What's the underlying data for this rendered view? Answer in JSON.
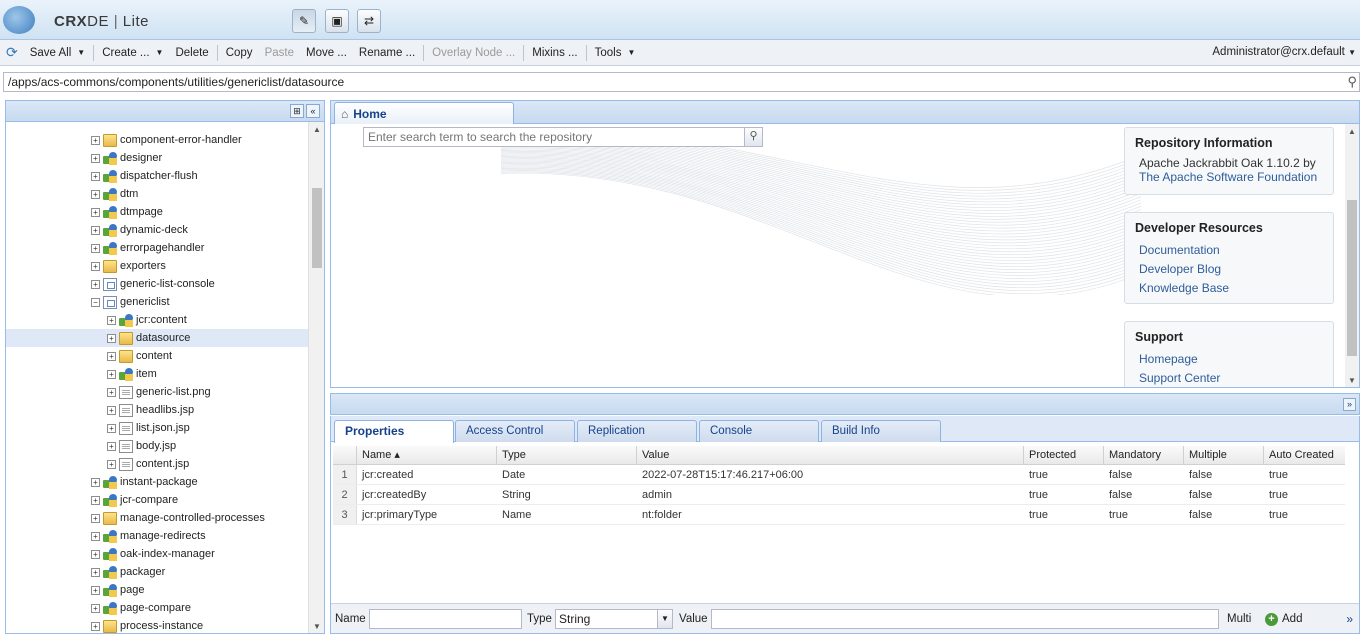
{
  "app": {
    "brand_bold": "CRX",
    "brand_rest": "DE",
    "brand_suffix": "Lite",
    "user": "Administrator@crx.default"
  },
  "toolbar": {
    "save_all": "Save All",
    "create": "Create ...",
    "delete": "Delete",
    "copy": "Copy",
    "paste": "Paste",
    "move": "Move ...",
    "rename": "Rename ...",
    "overlay_node": "Overlay Node ...",
    "mixins": "Mixins ...",
    "tools": "Tools"
  },
  "path": {
    "value": "/apps/acs-commons/components/utilities/genericlist/datasource"
  },
  "tree": {
    "items": [
      {
        "label": "component-error-handler",
        "icon": "folder"
      },
      {
        "label": "designer",
        "icon": "component"
      },
      {
        "label": "dispatcher-flush",
        "icon": "component"
      },
      {
        "label": "dtm",
        "icon": "component"
      },
      {
        "label": "dtmpage",
        "icon": "component"
      },
      {
        "label": "dynamic-deck",
        "icon": "component"
      },
      {
        "label": "errorpagehandler",
        "icon": "component"
      },
      {
        "label": "exporters",
        "icon": "folder"
      },
      {
        "label": "generic-list-console",
        "icon": "page"
      },
      {
        "label": "genericlist",
        "icon": "page"
      },
      {
        "label": "jcr:content",
        "icon": "component"
      },
      {
        "label": "datasource",
        "icon": "folder"
      },
      {
        "label": "content",
        "icon": "folder"
      },
      {
        "label": "item",
        "icon": "component"
      },
      {
        "label": "generic-list.png",
        "icon": "file"
      },
      {
        "label": "headlibs.jsp",
        "icon": "file"
      },
      {
        "label": "list.json.jsp",
        "icon": "file"
      },
      {
        "label": "body.jsp",
        "icon": "file"
      },
      {
        "label": "content.jsp",
        "icon": "file"
      },
      {
        "label": "instant-package",
        "icon": "component"
      },
      {
        "label": "jcr-compare",
        "icon": "component"
      },
      {
        "label": "manage-controlled-processes",
        "icon": "folder"
      },
      {
        "label": "manage-redirects",
        "icon": "component"
      },
      {
        "label": "oak-index-manager",
        "icon": "component"
      },
      {
        "label": "packager",
        "icon": "component"
      },
      {
        "label": "page",
        "icon": "component"
      },
      {
        "label": "page-compare",
        "icon": "component"
      },
      {
        "label": "process-instance",
        "icon": "folder"
      }
    ]
  },
  "home": {
    "tab_label": "Home",
    "search_placeholder": "Enter search term to search the repository",
    "repo_info": {
      "title": "Repository Information",
      "text": "Apache Jackrabbit Oak 1.10.2 by",
      "link": "The Apache Software Foundation"
    },
    "dev_resources": {
      "title": "Developer Resources",
      "links": [
        "Documentation",
        "Developer Blog",
        "Knowledge Base"
      ]
    },
    "support": {
      "title": "Support",
      "links": [
        "Homepage",
        "Support Center"
      ]
    }
  },
  "bottom_tabs": [
    "Properties",
    "Access Control",
    "Replication",
    "Console",
    "Build Info"
  ],
  "properties": {
    "columns": [
      "Name ▴",
      "Type",
      "Value",
      "Protected",
      "Mandatory",
      "Multiple",
      "Auto Created"
    ],
    "rows": [
      {
        "num": "1",
        "name": "jcr:created",
        "type": "Date",
        "value": "2022-07-28T15:17:46.217+06:00",
        "protected": "true",
        "mandatory": "false",
        "multiple": "false",
        "auto": "true"
      },
      {
        "num": "2",
        "name": "jcr:createdBy",
        "type": "String",
        "value": "admin",
        "protected": "true",
        "mandatory": "false",
        "multiple": "false",
        "auto": "true"
      },
      {
        "num": "3",
        "name": "jcr:primaryType",
        "type": "Name",
        "value": "nt:folder",
        "protected": "true",
        "mandatory": "true",
        "multiple": "false",
        "auto": "true"
      }
    ]
  },
  "addbar": {
    "name_label": "Name",
    "type_label": "Type",
    "type_value": "String",
    "value_label": "Value",
    "multi_label": "Multi",
    "add_label": "Add",
    "more": "»"
  }
}
